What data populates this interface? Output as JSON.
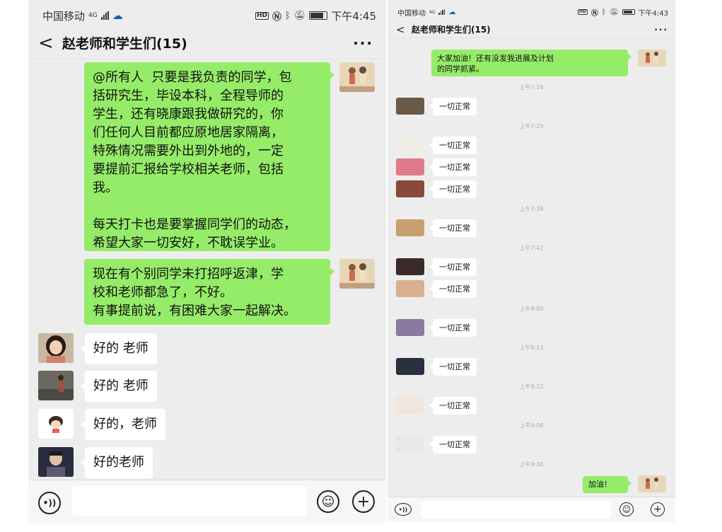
{
  "left": {
    "status": {
      "carrier": "中国移动",
      "network": "4G",
      "time": "下午4:45",
      "hd": "HD"
    },
    "nav": {
      "back": "<",
      "title": "赵老师和学生们(15)",
      "more": "···"
    },
    "teacher_messages": [
      {
        "text": "@所有人  只要是我负责的同学，包\n括研究生，毕设本科，全程导师的\n学生，还有晓康跟我做研究的，你\n们任何人目前都应原地居家隔离，\n特殊情况需要外出到外地的，一定\n要提前汇报给学校相关老师，包括\n我。\n\n每天打卡也是要掌握同学们的动态，\n希望大家一切安好，不耽误学业。"
      },
      {
        "text": "现在有个别同学未打招呼返津，学\n校和老师都急了，不好。\n有事提前说，有困难大家一起解决。"
      }
    ],
    "replies": [
      {
        "text": "好的 老师",
        "avatar_color": "#7a4a3a",
        "avatar_icon": "girl-portrait-icon"
      },
      {
        "text": "好的 老师",
        "avatar_color": "#5d6b5b",
        "avatar_icon": "street-scene-icon"
      },
      {
        "text": "好的，老师",
        "avatar_color": "#f2e6dc",
        "avatar_icon": "cartoon-girl-icon"
      },
      {
        "text": "好的老师",
        "avatar_color": "#2d2f45",
        "avatar_icon": "anime-man-icon"
      }
    ],
    "teacher_avatar_color": "#c9a27a"
  },
  "right": {
    "status": {
      "carrier": "中国移动",
      "network": "4G",
      "time": "下午4:43",
      "hd": "HD"
    },
    "nav": {
      "back": "<",
      "title": "赵老师和学生们(15)",
      "more": "···"
    },
    "top_message": {
      "text": "大家加油！还有没发我进展及计划\n的同学抓紧。"
    },
    "timeline": [
      {
        "time": "上午7:16",
        "replies": [
          {
            "text": "一切正常",
            "avatar_color": "#6b5a4a"
          }
        ]
      },
      {
        "time": "上午7:29",
        "replies": [
          {
            "text": "一切正常",
            "avatar_color": "#f0ece6"
          },
          {
            "text": "一切正常",
            "avatar_color": "#e07a8a"
          },
          {
            "text": "一切正常",
            "avatar_color": "#8a4a3a"
          }
        ]
      },
      {
        "time": "上午7:38",
        "replies": [
          {
            "text": "一切正常",
            "avatar_color": "#c8a070"
          }
        ]
      },
      {
        "time": "上午7:42",
        "replies": [
          {
            "text": "一切正常",
            "avatar_color": "#3a2a2a"
          },
          {
            "text": "一切正常",
            "avatar_color": "#d8b090"
          }
        ]
      },
      {
        "time": "上午8:00",
        "replies": [
          {
            "text": "一切正常",
            "avatar_color": "#8a7aa0"
          }
        ]
      },
      {
        "time": "上午8:13",
        "replies": [
          {
            "text": "一切正常",
            "avatar_color": "#2a3040"
          }
        ]
      },
      {
        "time": "上午8:22",
        "replies": [
          {
            "text": "一切正常",
            "avatar_color": "#f2e6dc"
          }
        ]
      },
      {
        "time": "上午9:08",
        "replies": [
          {
            "text": "一切正常",
            "avatar_color": "#e8e8e8"
          }
        ]
      },
      {
        "time": "上午9:30",
        "replies": []
      }
    ],
    "bottom_message": {
      "text": "加油！"
    },
    "teacher_avatar_color": "#c9a27a"
  },
  "input": {
    "voice_icon": "voice-icon",
    "emoji_icon": "emoji-icon",
    "add_icon": "plus-icon"
  },
  "colors": {
    "my_bubble": "#95ec69",
    "chat_bg": "#ededed",
    "other_bubble": "#ffffff"
  }
}
